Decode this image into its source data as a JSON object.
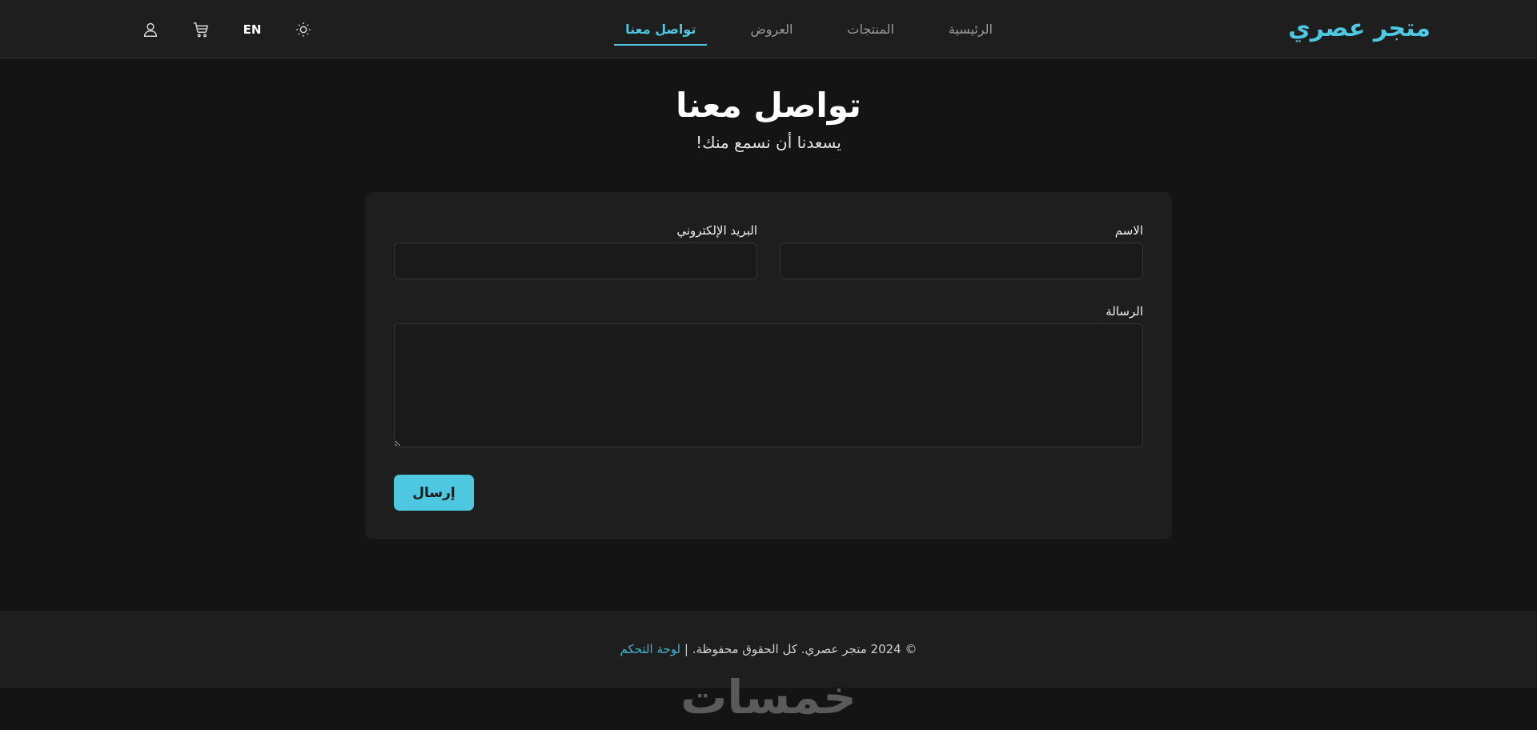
{
  "header": {
    "logo": "متجر عصري",
    "nav": [
      {
        "label": "الرئيسية",
        "active": false
      },
      {
        "label": "المنتجات",
        "active": false
      },
      {
        "label": "العروض",
        "active": false
      },
      {
        "label": "تواصل معنا",
        "active": true
      }
    ],
    "language_toggle": "EN",
    "icons": [
      "theme-toggle-icon",
      "cart-icon",
      "user-icon"
    ]
  },
  "page": {
    "title": "تواصل معنا",
    "subtitle": "يسعدنا أن نسمع منك!"
  },
  "form": {
    "name_label": "الاسم",
    "name_value": "",
    "email_label": "البريد الإلكتروني",
    "email_value": "",
    "message_label": "الرسالة",
    "message_value": "",
    "submit_label": "إرسال"
  },
  "footer": {
    "copyright": "© 2024 متجر عصري. كل الحقوق محفوظة. |",
    "dashboard_link": "لوحة التحكم"
  },
  "watermark": "خمسات",
  "colors": {
    "accent": "#4dc8e0",
    "background": "#141414",
    "surface": "#1e1e1e"
  }
}
